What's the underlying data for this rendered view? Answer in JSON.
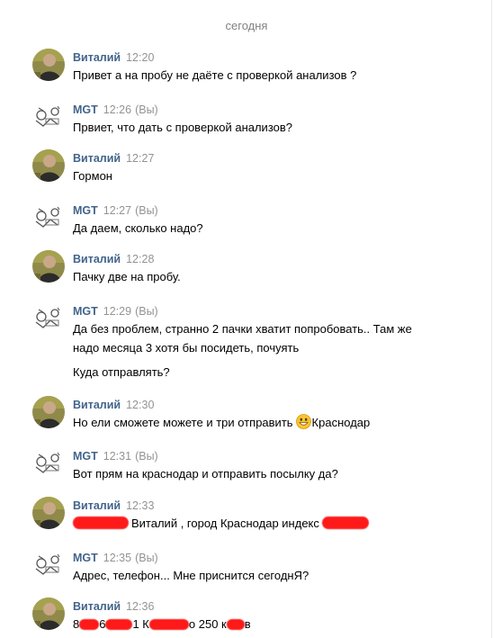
{
  "date_separator": "сегодня",
  "you_marker": "(Вы)",
  "messages": [
    {
      "author": "Виталий",
      "time": "12:20",
      "text": "Привет а на пробу не даёте с проверкой анализов ?"
    },
    {
      "author": "MGT",
      "time": "12:26",
      "text": "Првиет, что дать с проверкой анализов?"
    },
    {
      "author": "Виталий",
      "time": "12:27",
      "text": "Гормон"
    },
    {
      "author": "MGT",
      "time": "12:27",
      "text": "Да даем, сколько надо?"
    },
    {
      "author": "Виталий",
      "time": "12:28",
      "text": "Пачку две на пробу."
    },
    {
      "author": "MGT",
      "time": "12:29",
      "text_line1": "Да без проблем, странно 2 пачки хватит попробовать.. Там же",
      "text_line2": "надо месяца 3 хотя бы посидеть, почуять",
      "text_para2": "Куда отправлять?"
    },
    {
      "author": "Виталий",
      "time": "12:30",
      "text_before_emoji": "Но ели сможете можете и три отправить",
      "text_after_emoji": "Краснодар",
      "emoji": "grinning-face-emoji"
    },
    {
      "author": "MGT",
      "time": "12:31",
      "text": "Вот прям на краснодар и отправить посылку да?"
    },
    {
      "author": "Виталий",
      "time": "12:33",
      "text": "Виталий , город Краснодар индекс"
    },
    {
      "author": "MGT",
      "time": "12:35",
      "text": "Адрес, телефон... Мне приснится сегоднЯ?"
    },
    {
      "author": "Виталий",
      "time": "12:36",
      "text_prefix": "8",
      "text_mid": "6",
      "text_mid2": "1 К",
      "text_mid3": "о 250 к",
      "text_suffix": "в"
    }
  ],
  "colors": {
    "author_name": "#42648b",
    "meta_gray": "#939393",
    "redaction": "#ff1a1a"
  },
  "icons": {
    "user_avatar": "user-avatar-photo",
    "mgt_avatar": "mgt-logo-avatar"
  }
}
